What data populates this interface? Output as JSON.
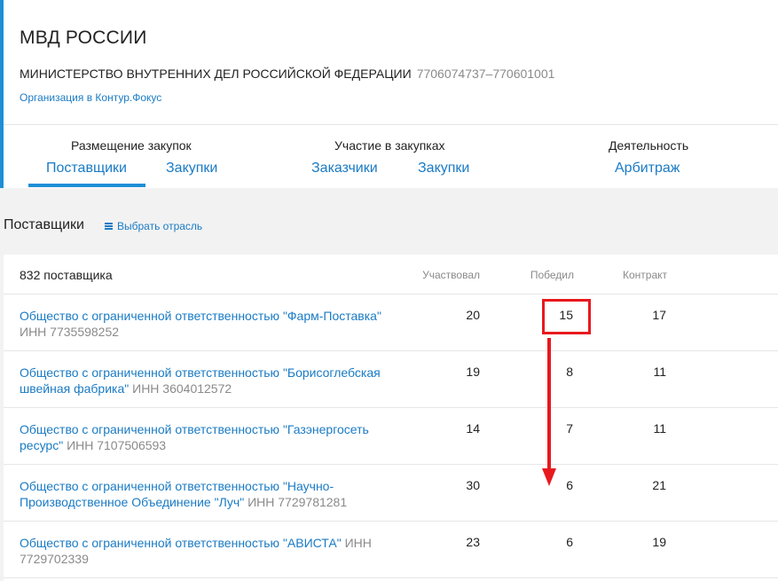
{
  "org": {
    "short_name": "МВД РОССИИ",
    "full_name": "МИНИСТЕРСТВО ВНУТРЕННИХ ДЕЛ РОССИЙСКОЙ ФЕДЕРАЦИИ",
    "inn_kpp": "7706074737–770601001",
    "kontur_link": "Организация в Контур.Фокус"
  },
  "nav": {
    "groups": [
      {
        "title": "Размещение закупок",
        "tabs": [
          "Поставщики",
          "Закупки"
        ]
      },
      {
        "title": "Участие в закупках",
        "tabs": [
          "Заказчики",
          "Закупки"
        ]
      },
      {
        "title": "Деятельность",
        "tabs": [
          "Арбитраж"
        ]
      }
    ],
    "active_tab": "Поставщики"
  },
  "section": {
    "title": "Поставщики",
    "industry_button": "Выбрать отрасль"
  },
  "table": {
    "count": "832 поставщика",
    "headers": {
      "participated": "Участвовал",
      "won": "Победил",
      "contract": "Контракт"
    },
    "rows": [
      {
        "name": "Общество с ограниченной ответственностью \"Фарм-Поставка\"",
        "inn": "ИНН 7735598252",
        "participated": "20",
        "won": "15",
        "contract": "17"
      },
      {
        "name": "Общество с ограниченной ответственностью \"Борисоглебская швейная фабрика\"",
        "inn": "ИНН 3604012572",
        "participated": "19",
        "won": "8",
        "contract": "11"
      },
      {
        "name": "Общество с ограниченной ответственностью \"Газэнергосеть ресурс\"",
        "inn": "ИНН 7107506593",
        "participated": "14",
        "won": "7",
        "contract": "11"
      },
      {
        "name": "Общество с ограниченной ответственностью \"Научно-Производственное Объединение \"Луч\"",
        "inn": "ИНН 7729781281",
        "participated": "30",
        "won": "6",
        "contract": "21"
      },
      {
        "name": "Общество с ограниченной ответственностью \"АВИСТА\"",
        "inn": "ИНН 7729702339",
        "participated": "23",
        "won": "6",
        "contract": "19"
      }
    ]
  },
  "colors": {
    "accent": "#1e8fd6",
    "link": "#1a7bc4",
    "annotation": "#e8191e"
  }
}
